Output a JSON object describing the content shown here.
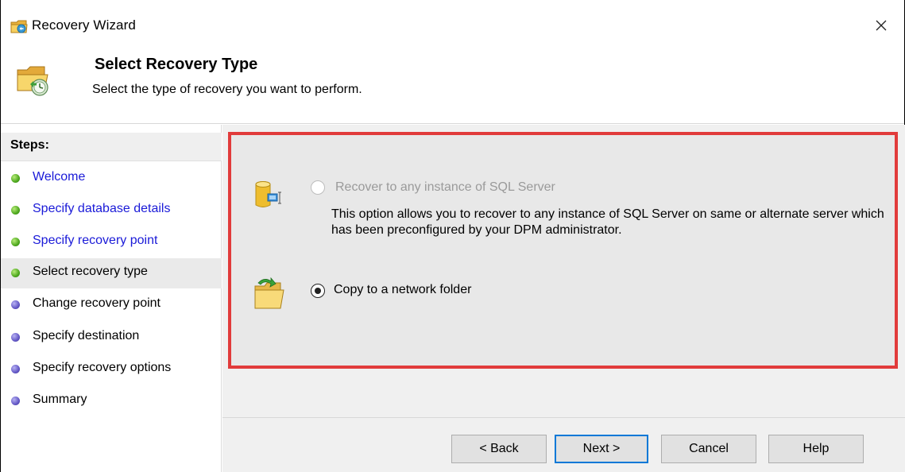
{
  "window": {
    "title": "Recovery Wizard",
    "close_symbol": "×"
  },
  "header": {
    "title": "Select Recovery Type",
    "subtitle": "Select the type of recovery you want to perform."
  },
  "sidebar": {
    "steps_label": "Steps:",
    "steps": [
      {
        "label": "Welcome",
        "state": "completed"
      },
      {
        "label": "Specify database details",
        "state": "completed"
      },
      {
        "label": "Specify recovery point",
        "state": "completed"
      },
      {
        "label": "Select recovery type",
        "state": "current"
      },
      {
        "label": "Change recovery point",
        "state": "pending"
      },
      {
        "label": "Specify destination",
        "state": "pending"
      },
      {
        "label": "Specify recovery options",
        "state": "pending"
      },
      {
        "label": "Summary",
        "state": "pending"
      }
    ]
  },
  "options": [
    {
      "label": "Recover to any instance of SQL Server",
      "description": "This option allows you to recover to any instance of SQL Server on same or alternate server which has been preconfigured by your DPM administrator.",
      "enabled": false,
      "selected": false,
      "icon": "sql-server-icon"
    },
    {
      "label": "Copy to a network folder",
      "enabled": true,
      "selected": true,
      "icon": "network-folder-icon"
    }
  ],
  "buttons": {
    "back": "< Back",
    "next": "Next >",
    "cancel": "Cancel",
    "help": "Help"
  },
  "colors": {
    "highlight_border": "#e13b3b",
    "link": "#1a1ad8",
    "completed_dot": "#4ea81e",
    "pending_dot": "#6358c6",
    "primary_button_border": "#0078d7"
  }
}
